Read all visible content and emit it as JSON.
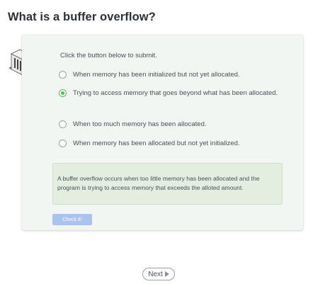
{
  "page": {
    "title": "What is a buffer overflow?"
  },
  "quiz": {
    "instructions": "Click the button below to submit.",
    "options": [
      {
        "label": "When memory has been initialized but not yet allocated.",
        "selected": false
      },
      {
        "label": "Trying to access memory that goes beyond what has been allocated.",
        "selected": true
      },
      {
        "label": "When too much memory has been allocated.",
        "selected": false
      },
      {
        "label": "When memory has been allocated but not yet initialized.",
        "selected": false
      }
    ],
    "feedback": "A buffer overflow occurs when too little memory has been allocated and the program is trying to access memory that exceeds the alloted amount.",
    "check_label": "Check It!",
    "icon": "server-icon"
  },
  "nav": {
    "next_label": "Next",
    "next_icon": "play-arrow-icon"
  },
  "colors": {
    "card_bg": "#f2f6f2",
    "feedback_bg": "#e3eee1",
    "selected_radio": "#5cb85c",
    "check_button": "#a9c3ec"
  }
}
